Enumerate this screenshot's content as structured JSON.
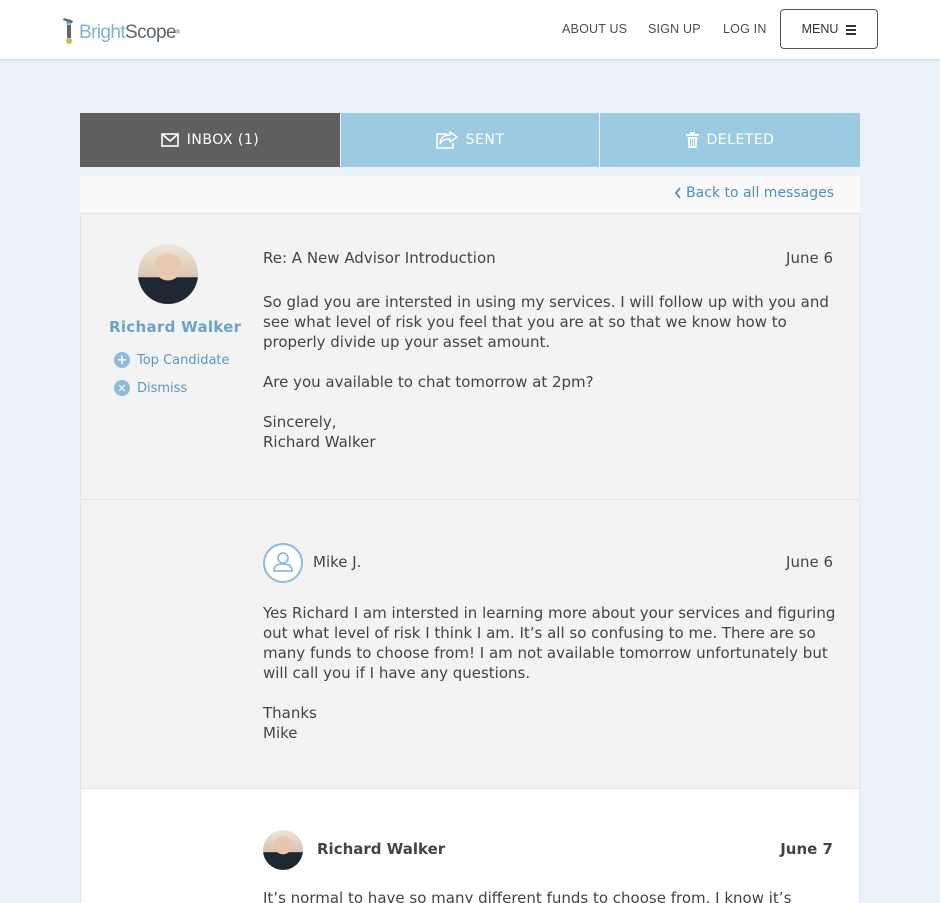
{
  "header": {
    "brand_part1": "Bright",
    "brand_part2": "Scope",
    "brand_reg": "®",
    "nav": [
      "ABOUT US",
      "SIGN UP",
      "LOG IN"
    ],
    "menu_label": "MENU"
  },
  "tabs": {
    "inbox": "INBOX (1)",
    "sent": "SENT",
    "deleted": "DELETED"
  },
  "back_link": "Back to all messages",
  "thread": {
    "sender": "Richard Walker",
    "actions": {
      "top_candidate": "Top Candidate",
      "dismiss": "Dismiss"
    },
    "messages": [
      {
        "subject": "Re: A New Advisor Introduction",
        "date": "June 6",
        "paragraphs": [
          "So glad you are intersted in using my services. I will follow up with you and see what level of risk you feel that you are at so that we know how to properly divide up your asset amount.",
          "Are you available to chat tomorrow at 2pm?"
        ],
        "signoff": "Sincerely,",
        "signature": "Richard Walker"
      },
      {
        "author": "Mike J.",
        "date": "June 6",
        "paragraphs": [
          "Yes Richard I am intersted in learning more about your services and figuring out what level of risk I think I am. It’s all so confusing to me.  There are so many funds to choose from! I am not available tomorrow unfortunately but will call you if I have any questions."
        ],
        "signoff": "Thanks",
        "signature": "Mike"
      },
      {
        "author": "Richard Walker",
        "date": "June 7",
        "paragraphs": [
          "It’s normal to have so many different funds to choose from. I know it’s"
        ]
      }
    ]
  },
  "colors": {
    "accent": "#6aa3c8",
    "tab_active": "#5f5f5f",
    "tab_inactive": "#9ccae3",
    "page_bg": "#eaf2f8"
  },
  "icons": {
    "inbox": "envelope-icon",
    "sent": "share-icon",
    "deleted": "trash-icon",
    "back": "chevron-left-icon",
    "top_candidate": "plus-circle-icon",
    "dismiss": "x-circle-icon",
    "menu": "hamburger-icon",
    "user": "user-outline-icon"
  }
}
